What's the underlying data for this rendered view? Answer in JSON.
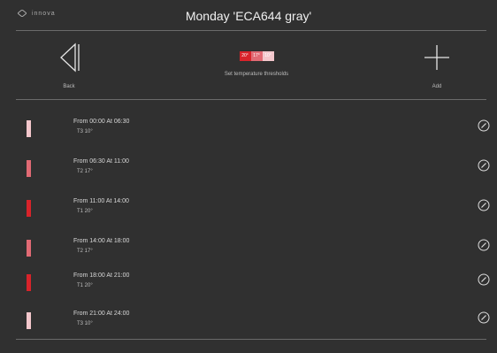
{
  "header": {
    "brand": "innova",
    "title": "Monday 'ECA644 gray'"
  },
  "toolbar": {
    "back_label": "Back",
    "thresholds_label": "Set temperature thresholds",
    "add_label": "Add",
    "chips": [
      {
        "text": "20°",
        "color": "#d8232a"
      },
      {
        "text": "17°",
        "color": "#e16a74"
      },
      {
        "text": "10°",
        "color": "#f3c7cc"
      }
    ]
  },
  "schedule": [
    {
      "time": "From 00:00 At 06:30",
      "level": "T3 10°",
      "color": "#f3c7cc"
    },
    {
      "time": "From 06:30 At 11:00",
      "level": "T2 17°",
      "color": "#e16a74"
    },
    {
      "time": "From 11:00 At 14:00",
      "level": "T1 20°",
      "color": "#d8232a"
    },
    {
      "time": "From 14:00 At 18:00",
      "level": "T2 17°",
      "color": "#e16a74"
    },
    {
      "time": "From 18:00 At 21:00",
      "level": "T1 20°",
      "color": "#d8232a"
    },
    {
      "time": "From 21:00 At 24:00",
      "level": "T3 10°",
      "color": "#f3c7cc"
    }
  ],
  "icons": {
    "back": "back-icon",
    "add": "plus-icon",
    "edit": "pencil-icon"
  }
}
